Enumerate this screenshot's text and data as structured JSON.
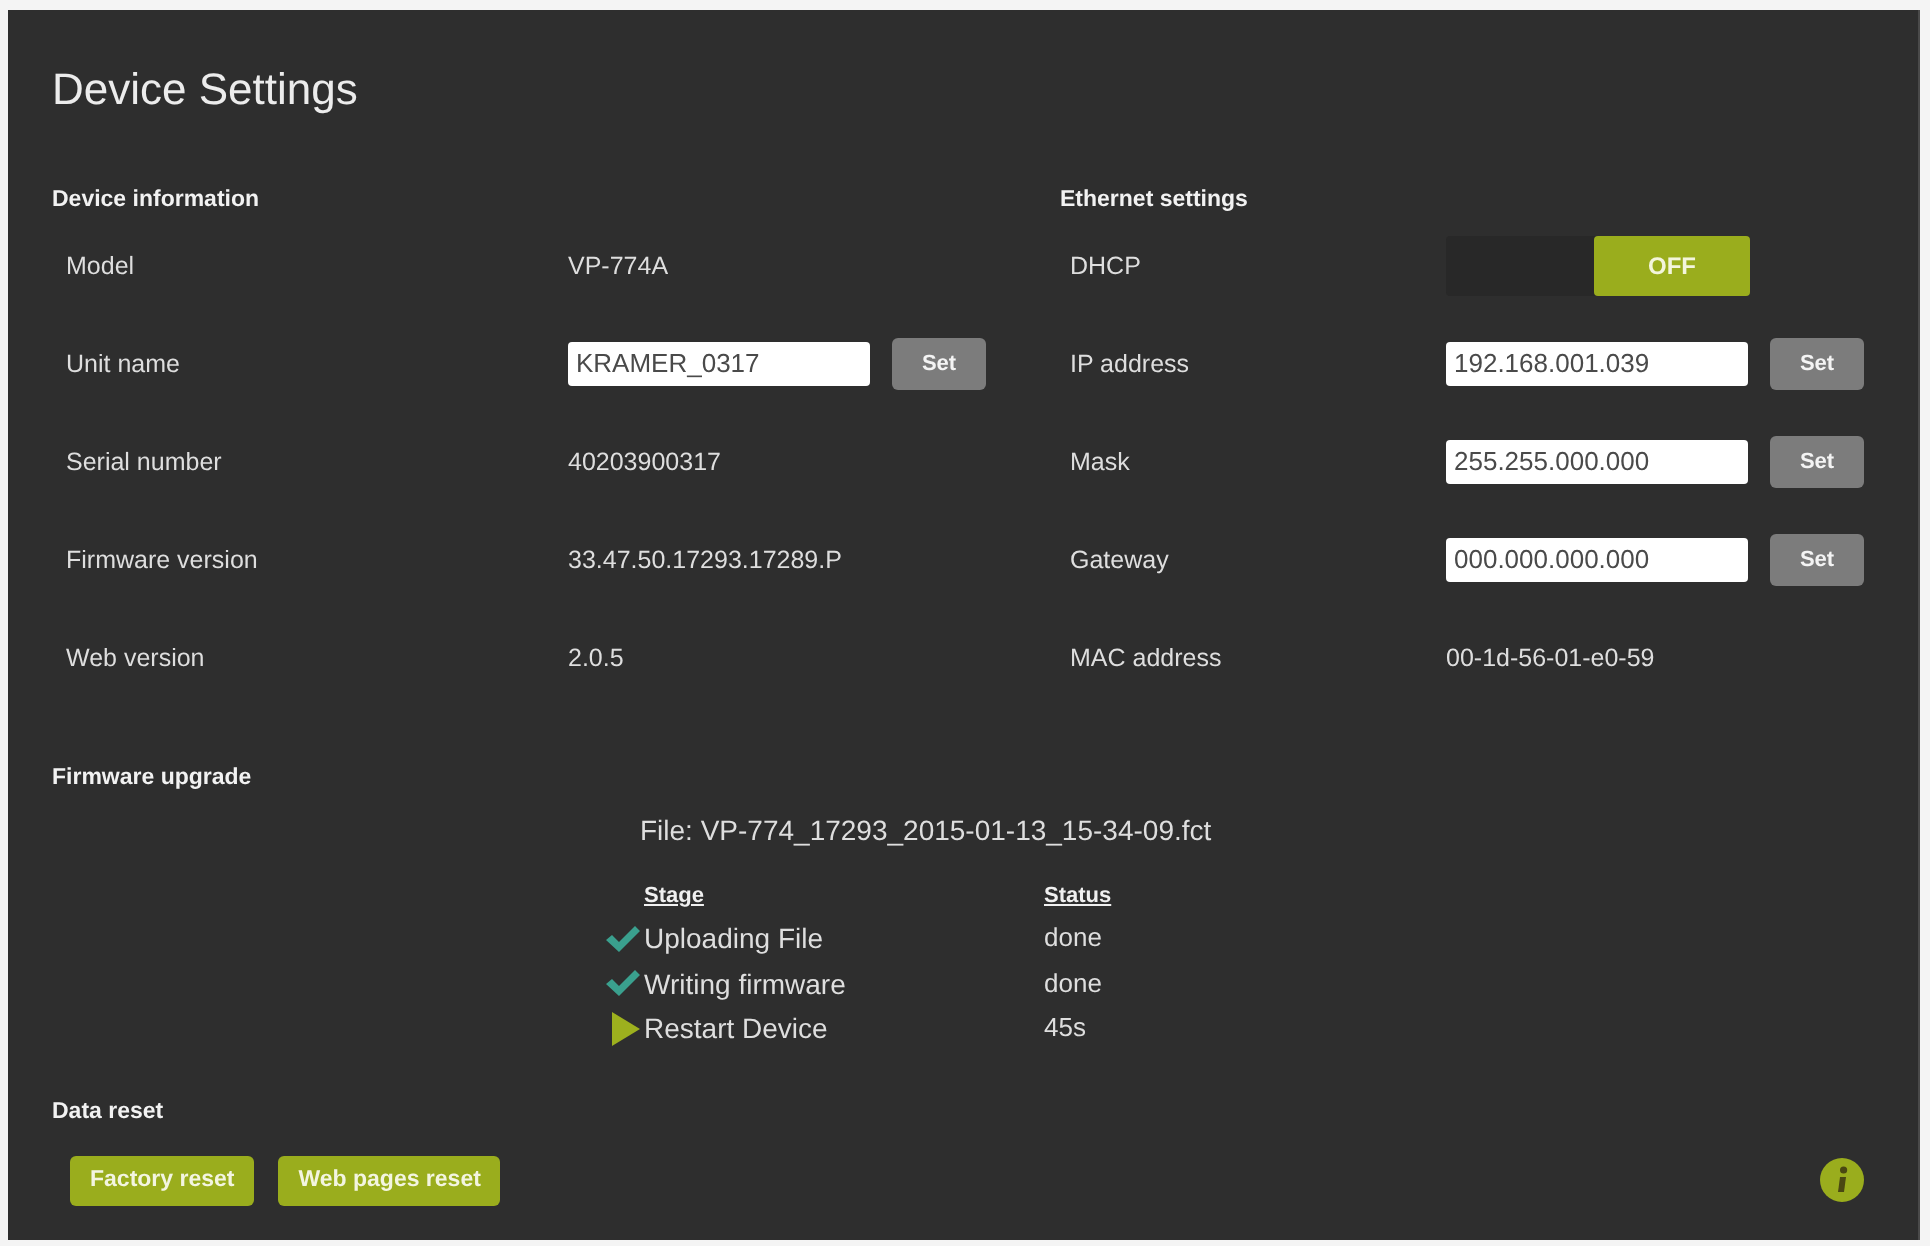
{
  "window": {
    "title": "Device Settings"
  },
  "device_information": {
    "heading": "Device information",
    "rows": [
      {
        "kind": "text",
        "label": "Model",
        "value": "VP-774A"
      },
      {
        "kind": "input",
        "label": "Unit name",
        "value": "KRAMER_0317",
        "button": "Set"
      },
      {
        "kind": "text",
        "label": "Serial number",
        "value": "40203900317"
      },
      {
        "kind": "text",
        "label": "Firmware version",
        "value": "33.47.50.17293.17289.P"
      },
      {
        "kind": "text",
        "label": "Web version",
        "value": "2.0.5"
      }
    ]
  },
  "ethernet_settings": {
    "heading": "Ethernet settings",
    "rows": [
      {
        "kind": "toggle",
        "label": "DHCP",
        "value": "OFF",
        "on": false
      },
      {
        "kind": "input",
        "label": "IP address",
        "value": "192.168.001.039",
        "button": "Set"
      },
      {
        "kind": "input",
        "label": "Mask",
        "value": "255.255.000.000",
        "button": "Set"
      },
      {
        "kind": "input",
        "label": "Gateway",
        "value": "000.000.000.000",
        "button": "Set"
      },
      {
        "kind": "text",
        "label": "MAC address",
        "value": "00-1d-56-01-e0-59"
      }
    ]
  },
  "firmware_upgrade": {
    "heading": "Firmware upgrade",
    "file": "File: VP-774_17293_2015-01-13_15-34-09.fct",
    "columns": [
      "Stage",
      "Status"
    ],
    "stages": [
      {
        "kind": "done",
        "stage": "Uploading File",
        "status": "done"
      },
      {
        "kind": "done",
        "stage": "Writing firmware",
        "status": "done"
      },
      {
        "kind": "current",
        "stage": "Restart Device",
        "status": "45s"
      }
    ]
  },
  "data_reset": {
    "heading": "Data reset",
    "buttons": [
      "Factory reset",
      "Web pages reset"
    ]
  }
}
